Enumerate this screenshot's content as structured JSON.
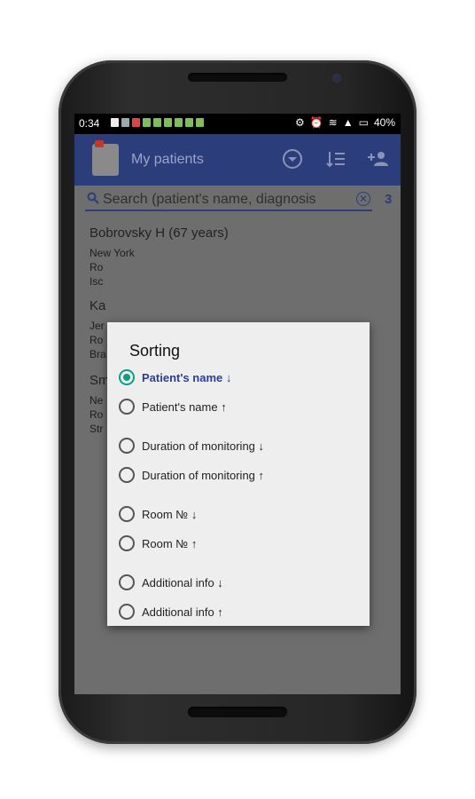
{
  "status": {
    "time": "0:34",
    "battery": "40%"
  },
  "app": {
    "title": "My patients"
  },
  "search": {
    "placeholder": "Search (patient's name, diagnosis",
    "count": "3"
  },
  "patients": [
    {
      "name": "Bobrovsky H (67 years)",
      "lines": [
        "New York",
        "Ro",
        "Isc"
      ]
    },
    {
      "name": "Ka",
      "lines": [
        "Jer",
        "Ro",
        "Bra"
      ]
    },
    {
      "name": "Sm",
      "lines": [
        "Ne",
        "Ro",
        "Str"
      ]
    }
  ],
  "dialog": {
    "title": "Sorting",
    "options": [
      {
        "label": "Patient's name ↓",
        "selected": true
      },
      {
        "label": "Patient's name ↑",
        "selected": false
      },
      {
        "label": "Duration of monitoring ↓",
        "selected": false
      },
      {
        "label": "Duration of monitoring ↑",
        "selected": false
      },
      {
        "label": "Room № ↓",
        "selected": false
      },
      {
        "label": "Room № ↑",
        "selected": false
      },
      {
        "label": "Additional info ↓",
        "selected": false
      },
      {
        "label": "Additional info ↑",
        "selected": false
      }
    ]
  },
  "icons": {
    "app_logo": "clipboard-icon",
    "filter": "filter-icon",
    "sort": "sort-icon",
    "add_patient": "add-person-icon",
    "search": "search-icon",
    "clear": "clear-icon"
  },
  "colors": {
    "appbar": "#2b3d7a",
    "accent": "#0e9e86",
    "selected_text": "#2b3d9a"
  }
}
